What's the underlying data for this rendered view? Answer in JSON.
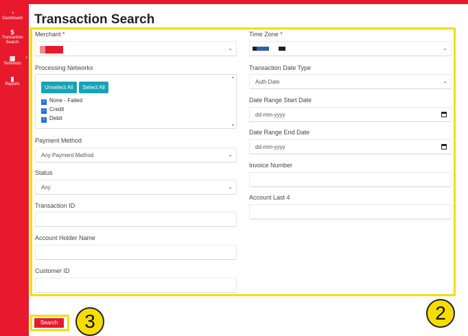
{
  "sidebar": {
    "items": [
      {
        "label": "Dashboard",
        "icon": "dashboard-gauge-icon",
        "glyph": "◔"
      },
      {
        "label": "Transaction Search",
        "icon": "dollar-icon",
        "glyph": "$"
      },
      {
        "label": "Terminals",
        "icon": "terminal-calculator-icon",
        "glyph": "▦"
      },
      {
        "label": "Reports",
        "icon": "reports-chart-icon",
        "glyph": "▮"
      }
    ]
  },
  "page": {
    "title": "Transaction Search"
  },
  "form": {
    "merchant": {
      "label": "Merchant",
      "required_mark": "*"
    },
    "processing_networks": {
      "label": "Processing Networks",
      "unselect_all": "Unselect All",
      "select_all": "Select All",
      "options": [
        "None - Failed",
        "Credit",
        "Debit"
      ]
    },
    "payment_method": {
      "label": "Payment Method",
      "value": "Any Payment Method"
    },
    "status": {
      "label": "Status",
      "value": "Any"
    },
    "transaction_id": {
      "label": "Transaction ID",
      "value": ""
    },
    "account_holder_name": {
      "label": "Account Holder Name",
      "value": ""
    },
    "customer_id": {
      "label": "Customer ID",
      "value": ""
    },
    "time_zone": {
      "label": "Time Zone",
      "required_mark": "*"
    },
    "transaction_date_type": {
      "label": "Transaction Date Type",
      "value": "Auth Date"
    },
    "date_range_start": {
      "label": "Date Range Start Date",
      "placeholder": "dd-mm-yyyy"
    },
    "date_range_end": {
      "label": "Date Range End Date",
      "placeholder": "dd-mm-yyyy"
    },
    "invoice_number": {
      "label": "Invoice Number",
      "value": ""
    },
    "account_last4": {
      "label": "Account Last 4",
      "value": ""
    },
    "search_button": "Search"
  },
  "annotations": {
    "badge_2": "2",
    "badge_3": "3"
  },
  "colors": {
    "brand_red": "#e8192c",
    "highlight_yellow": "#f5dd00",
    "teal": "#17a2b8"
  }
}
